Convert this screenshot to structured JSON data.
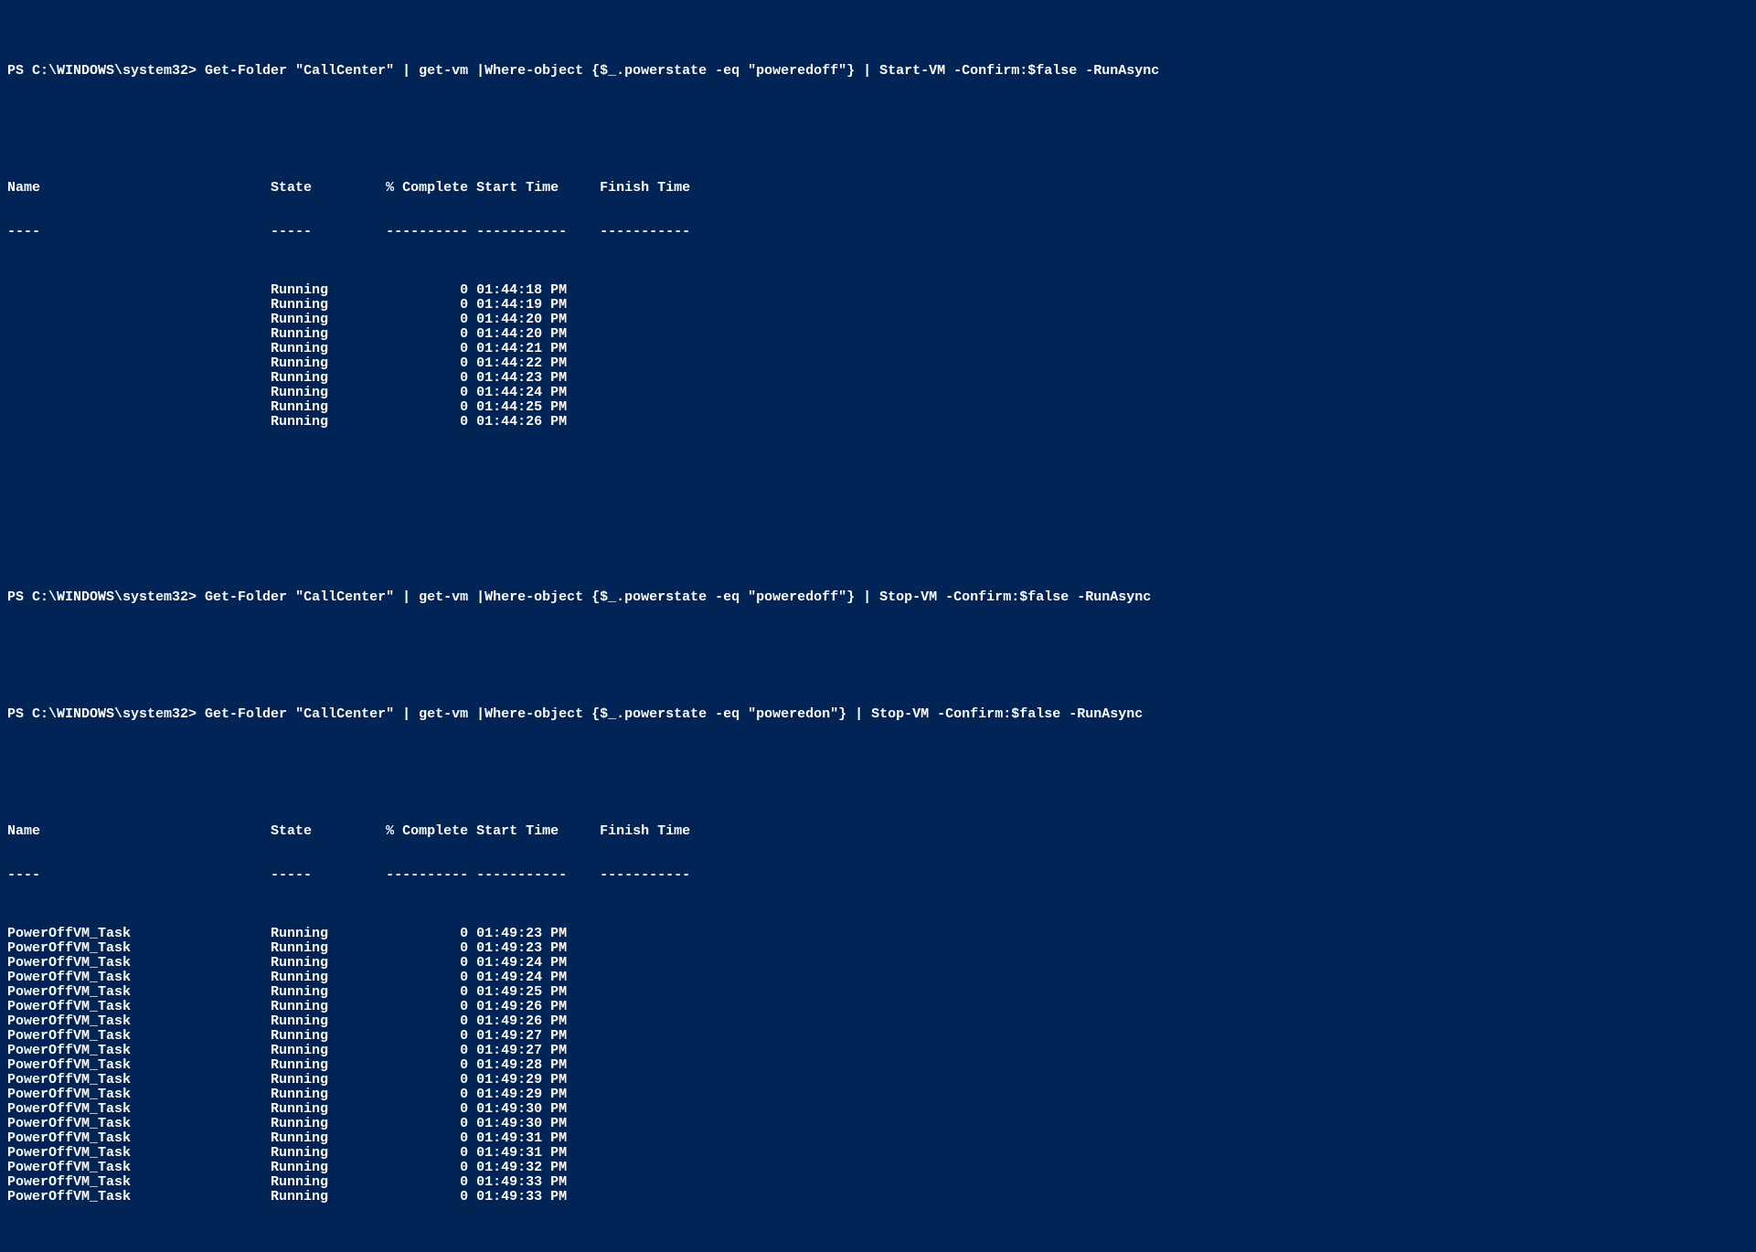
{
  "prompt_prefix": "PS C:\\WINDOWS\\system32> ",
  "commands": {
    "cmd1": "Get-Folder \"CallCenter\" | get-vm |Where-object {$_.powerstate -eq \"poweredoff\"} | Start-VM -Confirm:$false -RunAsync",
    "cmd2": "Get-Folder \"CallCenter\" | get-vm |Where-object {$_.powerstate -eq \"poweredoff\"} | Stop-VM -Confirm:$false -RunAsync",
    "cmd3": "Get-Folder \"CallCenter\" | get-vm |Where-object {$_.powerstate -eq \"poweredon\"} | Stop-VM -Confirm:$false -RunAsync"
  },
  "columns": {
    "name": "Name",
    "state": "State",
    "pct": "% Complete",
    "start": "Start Time",
    "finish": "Finish Time"
  },
  "table1_rows": [
    {
      "name": "",
      "state": "Running",
      "pct": "0",
      "start": "01:44:18 PM",
      "finish": ""
    },
    {
      "name": "",
      "state": "Running",
      "pct": "0",
      "start": "01:44:19 PM",
      "finish": ""
    },
    {
      "name": "",
      "state": "Running",
      "pct": "0",
      "start": "01:44:20 PM",
      "finish": ""
    },
    {
      "name": "",
      "state": "Running",
      "pct": "0",
      "start": "01:44:20 PM",
      "finish": ""
    },
    {
      "name": "",
      "state": "Running",
      "pct": "0",
      "start": "01:44:21 PM",
      "finish": ""
    },
    {
      "name": "",
      "state": "Running",
      "pct": "0",
      "start": "01:44:22 PM",
      "finish": ""
    },
    {
      "name": "",
      "state": "Running",
      "pct": "0",
      "start": "01:44:23 PM",
      "finish": ""
    },
    {
      "name": "",
      "state": "Running",
      "pct": "0",
      "start": "01:44:24 PM",
      "finish": ""
    },
    {
      "name": "",
      "state": "Running",
      "pct": "0",
      "start": "01:44:25 PM",
      "finish": ""
    },
    {
      "name": "",
      "state": "Running",
      "pct": "0",
      "start": "01:44:26 PM",
      "finish": ""
    }
  ],
  "table2_rows": [
    {
      "name": "PowerOffVM_Task",
      "state": "Running",
      "pct": "0",
      "start": "01:49:23 PM",
      "finish": ""
    },
    {
      "name": "PowerOffVM_Task",
      "state": "Running",
      "pct": "0",
      "start": "01:49:23 PM",
      "finish": ""
    },
    {
      "name": "PowerOffVM_Task",
      "state": "Running",
      "pct": "0",
      "start": "01:49:24 PM",
      "finish": ""
    },
    {
      "name": "PowerOffVM_Task",
      "state": "Running",
      "pct": "0",
      "start": "01:49:24 PM",
      "finish": ""
    },
    {
      "name": "PowerOffVM_Task",
      "state": "Running",
      "pct": "0",
      "start": "01:49:25 PM",
      "finish": ""
    },
    {
      "name": "PowerOffVM_Task",
      "state": "Running",
      "pct": "0",
      "start": "01:49:26 PM",
      "finish": ""
    },
    {
      "name": "PowerOffVM_Task",
      "state": "Running",
      "pct": "0",
      "start": "01:49:26 PM",
      "finish": ""
    },
    {
      "name": "PowerOffVM_Task",
      "state": "Running",
      "pct": "0",
      "start": "01:49:27 PM",
      "finish": ""
    },
    {
      "name": "PowerOffVM_Task",
      "state": "Running",
      "pct": "0",
      "start": "01:49:27 PM",
      "finish": ""
    },
    {
      "name": "PowerOffVM_Task",
      "state": "Running",
      "pct": "0",
      "start": "01:49:28 PM",
      "finish": ""
    },
    {
      "name": "PowerOffVM_Task",
      "state": "Running",
      "pct": "0",
      "start": "01:49:29 PM",
      "finish": ""
    },
    {
      "name": "PowerOffVM_Task",
      "state": "Running",
      "pct": "0",
      "start": "01:49:29 PM",
      "finish": ""
    },
    {
      "name": "PowerOffVM_Task",
      "state": "Running",
      "pct": "0",
      "start": "01:49:30 PM",
      "finish": ""
    },
    {
      "name": "PowerOffVM_Task",
      "state": "Running",
      "pct": "0",
      "start": "01:49:30 PM",
      "finish": ""
    },
    {
      "name": "PowerOffVM_Task",
      "state": "Running",
      "pct": "0",
      "start": "01:49:31 PM",
      "finish": ""
    },
    {
      "name": "PowerOffVM_Task",
      "state": "Running",
      "pct": "0",
      "start": "01:49:31 PM",
      "finish": ""
    },
    {
      "name": "PowerOffVM_Task",
      "state": "Running",
      "pct": "0",
      "start": "01:49:32 PM",
      "finish": ""
    },
    {
      "name": "PowerOffVM_Task",
      "state": "Running",
      "pct": "0",
      "start": "01:49:33 PM",
      "finish": ""
    },
    {
      "name": "PowerOffVM_Task",
      "state": "Running",
      "pct": "0",
      "start": "01:49:33 PM",
      "finish": ""
    }
  ]
}
